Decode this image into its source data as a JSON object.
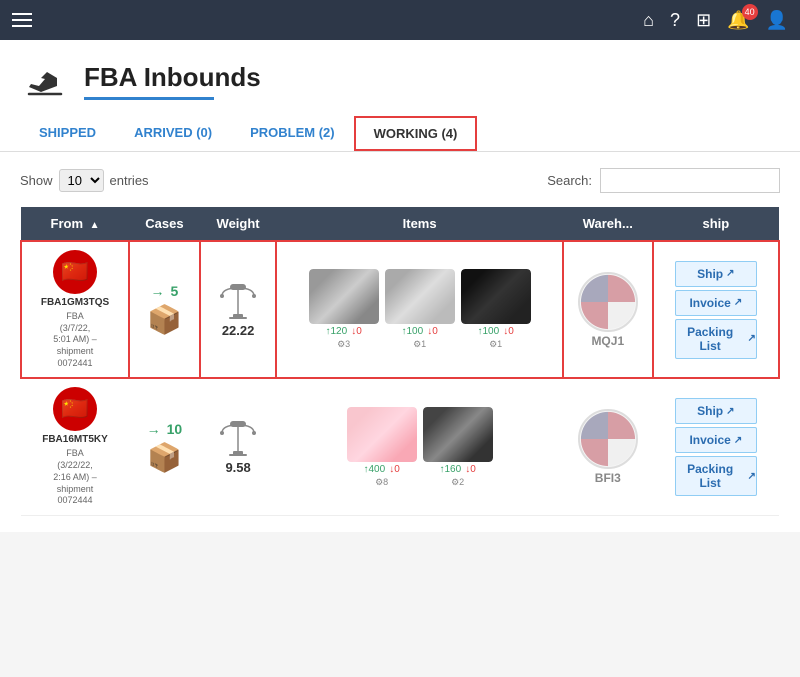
{
  "topNav": {
    "notifications": "40"
  },
  "pageHeader": {
    "title": "FBA Inbounds",
    "underlineColor": "#3182ce"
  },
  "tabs": [
    {
      "label": "SHIPPED",
      "active": false
    },
    {
      "label": "ARRIVED (0)",
      "active": false
    },
    {
      "label": "PROBLEM (2)",
      "active": false
    },
    {
      "label": "WORKING (4)",
      "active": true
    }
  ],
  "controls": {
    "showLabel": "Show",
    "showValue": "10",
    "entriesLabel": "entries",
    "searchLabel": "Search:"
  },
  "tableHeaders": [
    {
      "label": "From",
      "sortable": true
    },
    {
      "label": "Cases",
      "sortable": false
    },
    {
      "label": "Weight",
      "sortable": false
    },
    {
      "label": "Items",
      "sortable": false
    },
    {
      "label": "Wareh...",
      "sortable": false
    },
    {
      "label": "ship",
      "sortable": false
    }
  ],
  "rows": [
    {
      "from": {
        "id": "FBA1GM3TQS",
        "sub": "FBA\n(3/7/22,\n5:01 AM) –\nshipment\n0072441"
      },
      "cases": {
        "count": 5,
        "arrow": "→"
      },
      "weight": {
        "value": "22.22"
      },
      "items": [
        {
          "type": "headband",
          "up": 120,
          "down": 0,
          "sku": 3
        },
        {
          "type": "earphones",
          "up": 100,
          "down": 0,
          "sku": 1
        },
        {
          "type": "glasses",
          "up": 100,
          "down": 0,
          "sku": 1
        }
      ],
      "warehouse": {
        "code": "MQJ1"
      },
      "actions": [
        "Ship ↗",
        "Invoice ↗",
        "Packing List ↗"
      ]
    },
    {
      "from": {
        "id": "FBA16MT5KY",
        "sub": "FBA\n(3/22/22,\n2:16 AM) –\nshipment\n0072444"
      },
      "cases": {
        "count": 10,
        "arrow": "→"
      },
      "weight": {
        "value": "9.58"
      },
      "items": [
        {
          "type": "cat-ears",
          "up": 400,
          "down": 0,
          "sku": 8
        },
        {
          "type": "cable",
          "up": 160,
          "down": 0,
          "sku": 2
        }
      ],
      "warehouse": {
        "code": "BFI3"
      },
      "actions": [
        "Ship ↗",
        "Invoice ↗",
        "Packing List ↗"
      ]
    }
  ]
}
